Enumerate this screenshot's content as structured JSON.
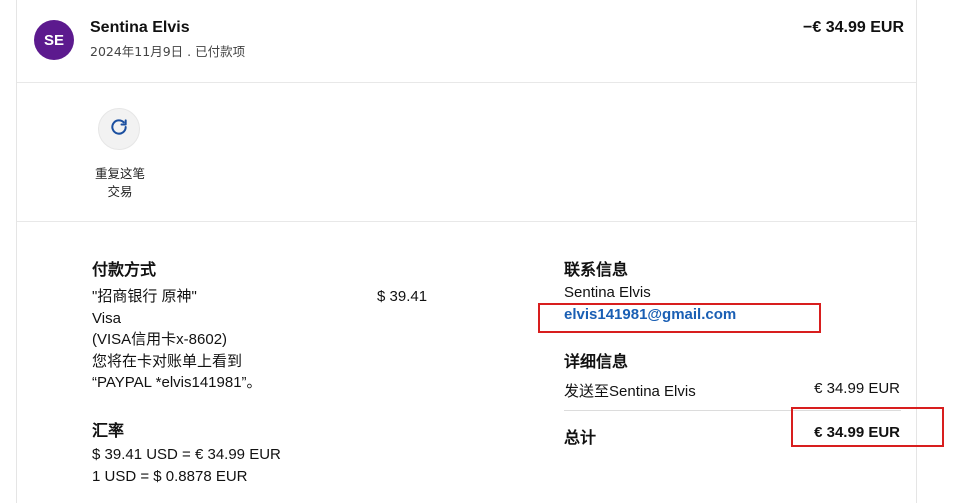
{
  "header": {
    "avatar_initials": "SE",
    "name": "Sentina Elvis",
    "subtitle": "2024年11月9日 . 已付款项",
    "amount": "−€ 34.99 EUR"
  },
  "repeat": {
    "label_line1": "重复这笔",
    "label_line2": "交易"
  },
  "payment": {
    "title": "付款方式",
    "lines": [
      "\"招商银行 原神\"",
      "Visa",
      "(VISA信用卡x-8602)",
      "您将在卡对账单上看到",
      "“PAYPAL *elvis141981”。"
    ],
    "amount": "$ 39.41"
  },
  "exchange": {
    "title": "汇率",
    "line1": "$ 39.41 USD = € 34.99 EUR",
    "line2": "1 USD = $ 0.8878 EUR"
  },
  "contact": {
    "title": "联系信息",
    "name": "Sentina Elvis",
    "email": "elvis141981@gmail.com"
  },
  "details": {
    "title": "详细信息",
    "sent_to_label": "发送至Sentina Elvis",
    "sent_to_amount": "€ 34.99 EUR",
    "total_label": "总计",
    "total_amount": "€ 34.99 EUR"
  },
  "colors": {
    "avatar": "#5c1a8e",
    "link": "#1a5fb4",
    "highlight_box": "#d81e1e"
  }
}
